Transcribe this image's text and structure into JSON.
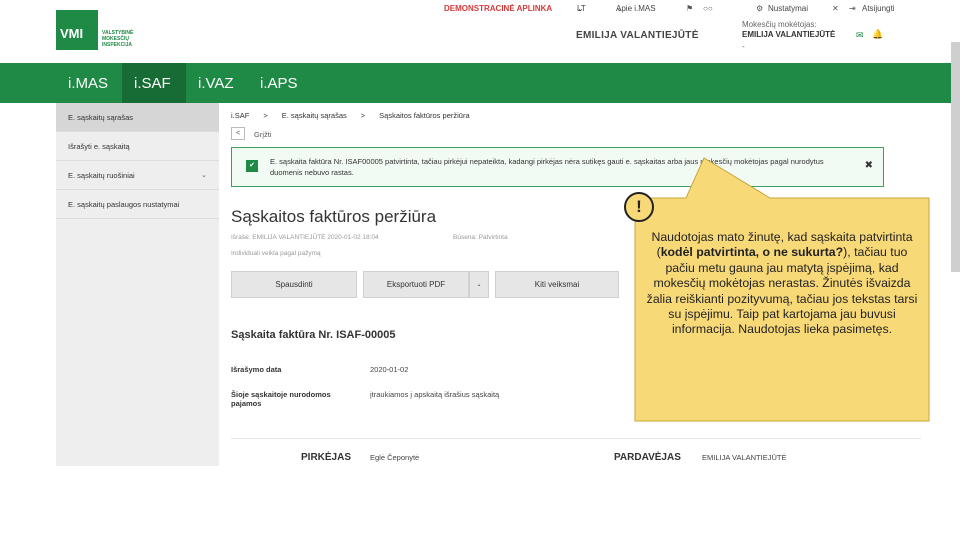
{
  "logo": {
    "text": "VMI",
    "subtitle": "VALSTYBINĖ MOKESČIŲ INSPEKCIJA"
  },
  "topnav": {
    "demo": "DEMONSTRACINĖ APLINKA",
    "language": "LT",
    "about": "Apie i.MAS",
    "settings": "Nustatymai",
    "logout": "Atsijungti"
  },
  "user": {
    "name": "EMILIJA VALANTIEJŪTĖ",
    "taxpayer_label": "Mokesčių mokėtojas:",
    "taxpayer_name": "EMILIJA VALANTIEJŪTĖ",
    "dash": "-"
  },
  "mainnav": {
    "tabs": [
      "i.MAS",
      "i.SAF",
      "i.VAZ",
      "i.APS"
    ],
    "active": "i.SAF"
  },
  "sidebar": {
    "items": [
      "E. sąskaitų sąrašas",
      "Išrašyti e. sąskaitą",
      "E. sąskaitų ruošiniai",
      "E. sąskaitų paslaugos nustatymai"
    ]
  },
  "breadcrumbs": [
    "i.SAF",
    ">",
    "E. sąskaitų sąrašas",
    ">",
    "Sąskaitos faktūros peržiūra"
  ],
  "back": {
    "icon": "<",
    "label": "Grįžti"
  },
  "alert": {
    "text": "E. sąskaita faktūra Nr. ISAF00005 patvirtinta, tačiau pirkėjui nepateikta, kadangi pirkėjas nėra sutikęs gauti e. sąskaitas arba jaus mokesčių mokėtojas pagal nurodytus duomenis nebuvo rastas.",
    "check": "✔",
    "close": "✖"
  },
  "page": {
    "title": "Sąskaitos faktūros peržiūra",
    "meta1": "Išrašė: EMILIJA VALANTIEJŪTĖ 2020-01-02 18:04",
    "status": "Būsena: Patvirtinta",
    "meta2": "Individuali veikla pagal pažymą"
  },
  "actions": {
    "print": "Spausdinti",
    "export_pdf": "Eksportuoti PDF",
    "dropdown": "⌄",
    "more": "Kiti veiksmai"
  },
  "invoice": {
    "title": "Sąskaita faktūra Nr. ISAF-00005",
    "date_label": "Išrašymo data",
    "date_value": "2020-01-02",
    "included_label": "Šioje sąskaitoje nurodomos pajamos",
    "included_value": "įtraukiamos į apskaitą išrašius sąskaitą",
    "buyer_label": "PIRKĖJAS",
    "buyer_name": "Eglė Čeponytė",
    "seller_label": "PARDAVĖJAS",
    "seller_name": "EMILIJA VALANTIEJŪTĖ"
  },
  "callout": {
    "mark": "!",
    "part1": "Naudotojas mato žinutę, kad sąskaita patvirtinta (",
    "bold": "kodėl patvirtinta, o ne sukurta?",
    "part2": "), tačiau tuo pačiu metu gauna jau matytą įspėjimą, kad mokesčių mokėtojas nerastas. Žinutės išvaizda žalia reiškianti pozityvumą, tačiau jos tekstas tarsi su įspėjimu. Taip pat kartojama jau buvusi informacija. Naudotojas lieka pasimetęs.",
    "color": "#f8d978"
  }
}
